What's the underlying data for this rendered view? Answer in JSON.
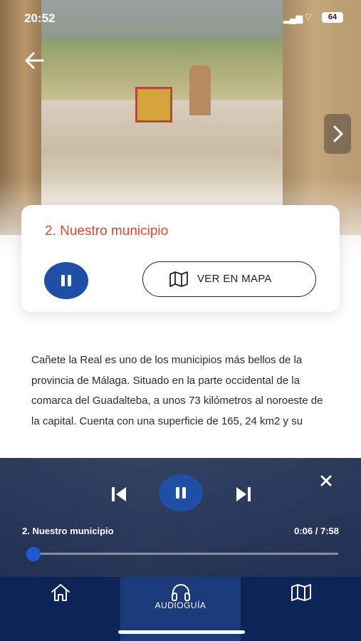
{
  "status_bar": {
    "time": "20:52",
    "battery": "64"
  },
  "card": {
    "title": "2. Nuestro municipio",
    "map_button_label": "VER EN MAPA"
  },
  "description": "Cañete la Real es uno de los municipios más bellos de la provincia de Málaga. Situado en la parte occidental de la comarca del Guadalteba, a unos 73 kilómetros al noroeste de la capital. Cuenta con una superficie de 165, 24 km2 y su",
  "player": {
    "track_title": "2. Nuestro municipio",
    "time": "0:06 / 7:58",
    "progress": 0.0126
  },
  "tabbar": {
    "tabs": [
      {
        "name": "home",
        "label": "",
        "icon": "home-icon"
      },
      {
        "name": "audioguia",
        "label": "AUDIOGUÍA",
        "icon": "headphones-icon",
        "active": true
      },
      {
        "name": "map",
        "label": "",
        "icon": "map-icon"
      }
    ]
  },
  "colors": {
    "accent": "#e0482f",
    "primary": "#1f4fa6",
    "tabbar": "#0d2456"
  }
}
